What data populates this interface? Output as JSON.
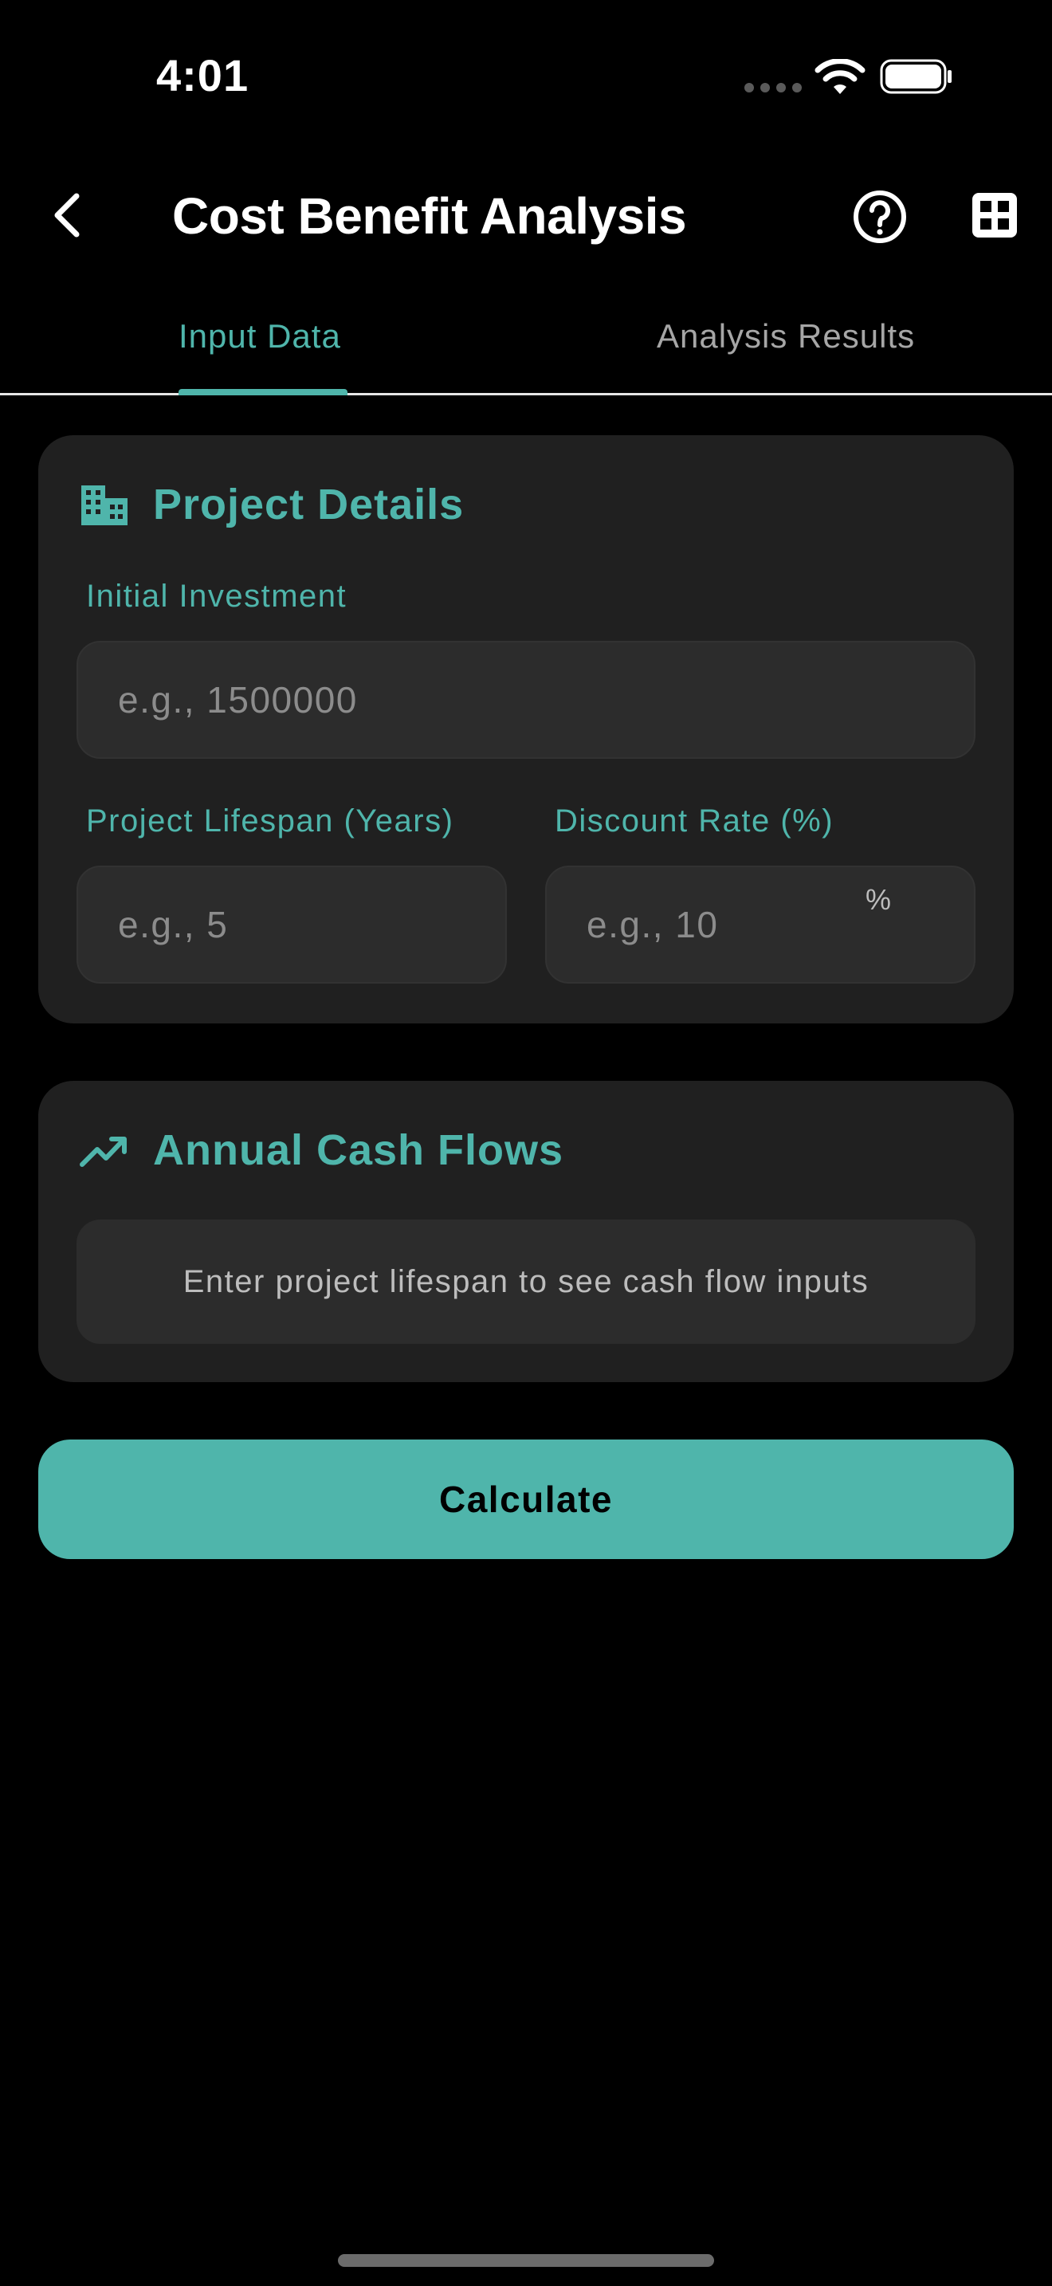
{
  "status_bar": {
    "time": "4:01"
  },
  "header": {
    "title": "Cost Benefit Analysis"
  },
  "tabs": [
    {
      "label": "Input Data",
      "active": true
    },
    {
      "label": "Analysis Results",
      "active": false
    }
  ],
  "project_details": {
    "title": "Project Details",
    "icon": "building-icon",
    "initial_investment": {
      "label": "Initial Investment",
      "value": "",
      "placeholder": "e.g., 1500000"
    },
    "lifespan": {
      "label": "Project Lifespan (Years)",
      "value": "",
      "placeholder": "e.g., 5"
    },
    "discount_rate": {
      "label": "Discount Rate (%)",
      "value": "",
      "placeholder": "e.g., 10",
      "suffix": "%"
    }
  },
  "cash_flows": {
    "title": "Annual Cash Flows",
    "icon": "trending-up-icon",
    "empty_message": "Enter project lifespan to see cash flow inputs"
  },
  "actions": {
    "calculate_label": "Calculate"
  },
  "colors": {
    "accent": "#4fb5ab",
    "background": "#000000",
    "card": "#202020",
    "input": "#2c2c2c"
  }
}
